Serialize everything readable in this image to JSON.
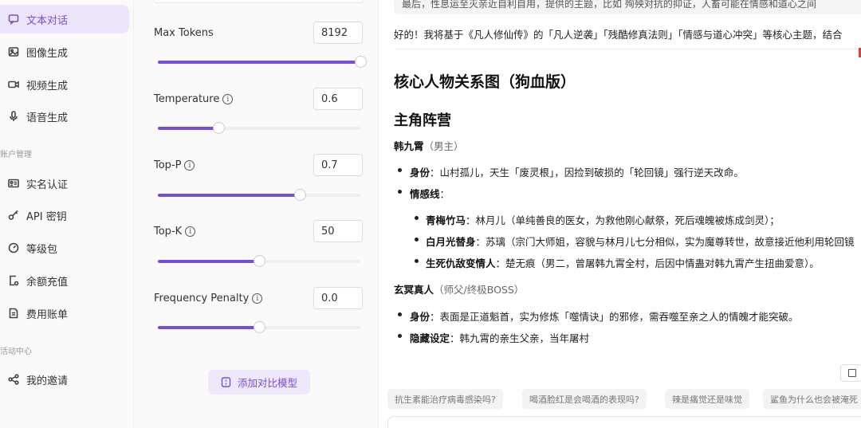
{
  "sidebar": {
    "items": [
      {
        "label": "文本对话",
        "icon": "chat-bubble-icon",
        "active": true
      },
      {
        "label": "图像生成",
        "icon": "image-icon"
      },
      {
        "label": "视频生成",
        "icon": "video-camera-icon"
      },
      {
        "label": "语音生成",
        "icon": "microphone-icon"
      }
    ],
    "account_section": "账户管理",
    "account_items": [
      {
        "label": "实名认证",
        "icon": "id-card-icon"
      },
      {
        "label": "API 密钥",
        "icon": "key-icon"
      },
      {
        "label": "等级包",
        "icon": "gauge-icon"
      },
      {
        "label": "余额充值",
        "icon": "recharge-icon"
      },
      {
        "label": "费用账单",
        "icon": "bill-icon"
      }
    ],
    "activity_section": "活动中心",
    "activity_items": [
      {
        "label": "我的邀请",
        "icon": "share-icon"
      }
    ]
  },
  "params": {
    "max_tokens": {
      "label": "Max Tokens",
      "value": "8192",
      "level": 1.0
    },
    "temperature": {
      "label": "Temperature",
      "value": "0.6",
      "level": 0.3
    },
    "top_p": {
      "label": "Top-P",
      "value": "0.7",
      "level": 0.7
    },
    "top_k": {
      "label": "Top-K",
      "value": "50",
      "level": 0.5
    },
    "frequency_penalty": {
      "label": "Frequency Penalty",
      "value": "0.0",
      "level": 0.5
    },
    "add_compare_label": "添加对比模型"
  },
  "chat": {
    "user_message": "最后，性息运至灭亲近自利自用，提供的主题，比如 殉殃对抗的抑证，人畜可能在情感和道心之间",
    "intro": "好的！我将基于《凡人修仙传》的「凡人逆袭」「残酷修真法则」「情感与道心冲突」等核心主题，结合",
    "heading1": "核心人物关系图（狗血版）",
    "heading2": "主角阵营",
    "protagonist_name": "韩九霄",
    "protagonist_role": "（男主）",
    "identity_label": "身份",
    "identity_text": "：山村孤儿，天生「废灵根」，因捡到破损的「轮回镜」强行逆天改命。",
    "emotion_label": "情感线",
    "emotion_text": "：",
    "sub1_label": "青梅竹马",
    "sub1_text": "：林月儿（单纯善良的医女，为救他刚心献祭，死后魂魄被炼成剑灵）；",
    "sub2_label": "白月光替身",
    "sub2_text": "：苏璃（宗门大师姐，容貌与林月儿七分相似，实为魔尊转世，故意接近他利用轮回镜",
    "sub3_label": "生死仇敌变情人",
    "sub3_text": "：楚无痕（男二，曾屠韩九霄全村，后因中情蛊对韩九霄产生扭曲爱意）。",
    "mentor_name": "玄冥真人",
    "mentor_role": "（师父/终极BOSS）",
    "mentor_identity_label": "身份",
    "mentor_identity_text": "：表面是正道魁首，实为修炼「噬情诀」的邪修，需吞噬至亲之人的情魄才能突破。",
    "mentor_secret_label": "隐藏设定",
    "mentor_secret_text": "：韩九霄的亲生父亲，当年屠村"
  },
  "suggestions": [
    "抗生素能治疗病毒感染吗?",
    "喝酒脸红是会喝酒的表现吗?",
    "辣是痛觉还是味觉",
    "鲨鱼为什么也会被淹死"
  ],
  "colors": {
    "accent": "#7a4cdc",
    "accent_bg": "#ede5fb"
  }
}
